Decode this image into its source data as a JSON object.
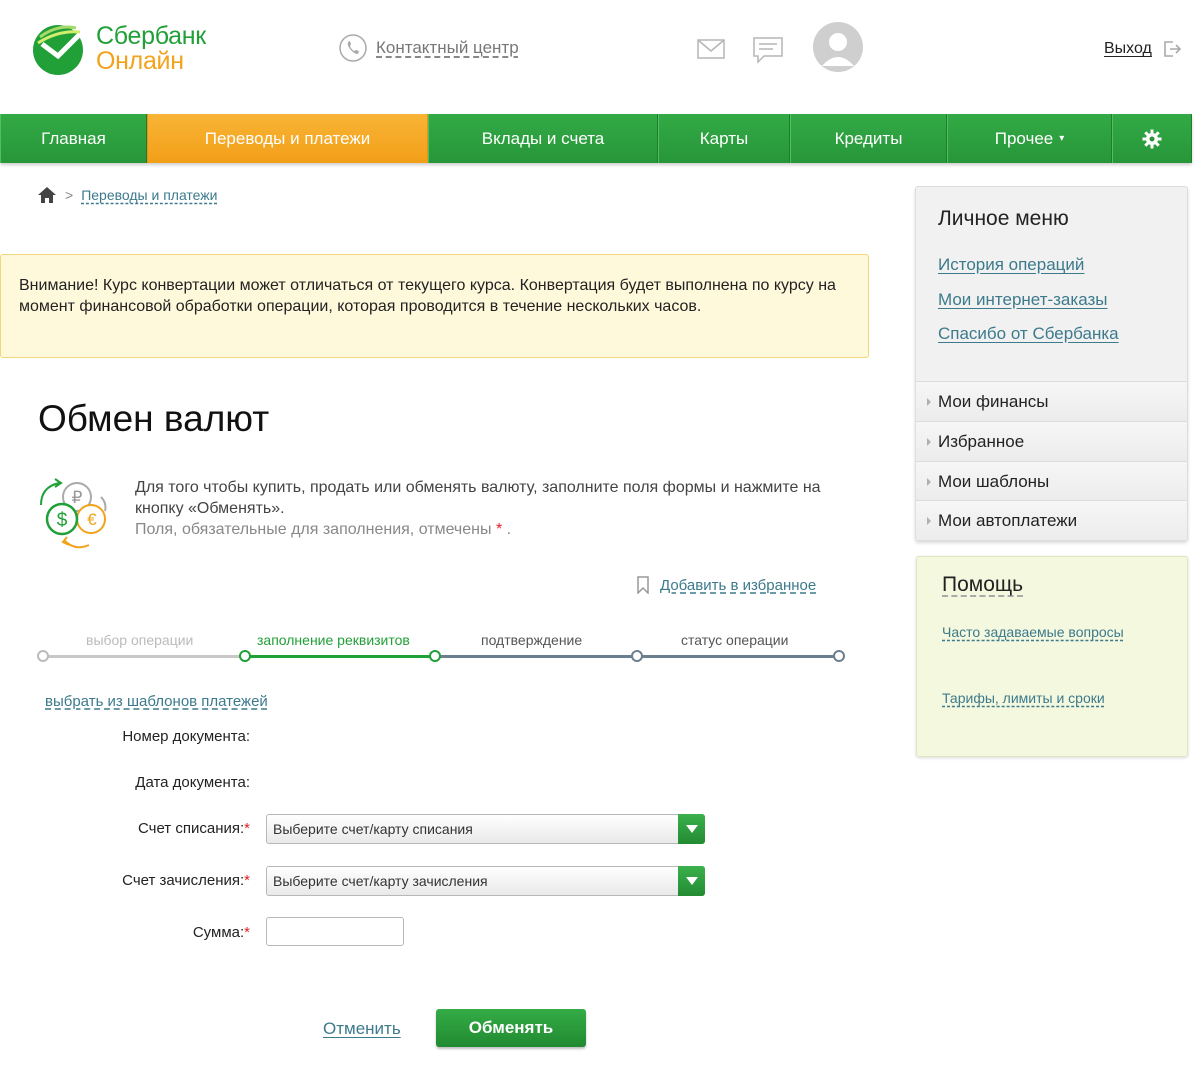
{
  "header": {
    "logo_line1": "Сбербанк",
    "logo_line2": "Онлайн",
    "contact_label": "Контактный центр",
    "exit_label": "Выход"
  },
  "nav": {
    "items": [
      {
        "label": "Главная",
        "active": false
      },
      {
        "label": "Переводы и платежи",
        "active": true
      },
      {
        "label": "Вклады и счета",
        "active": false
      },
      {
        "label": "Карты",
        "active": false
      },
      {
        "label": "Кредиты",
        "active": false
      },
      {
        "label": "Прочее",
        "active": false,
        "dropdown": true
      }
    ],
    "settings_icon": "gear-icon"
  },
  "breadcrumb": {
    "home_icon": "home-icon",
    "current": "Переводы и платежи"
  },
  "notice": {
    "text": "Внимание! Курс конвертации может отличаться от текущего курса. Конвертация будет выполнена по курсу на момент финансовой обработки операции, которая проводится в течение нескольких часов."
  },
  "page": {
    "title": "Обмен валют",
    "intro": "Для того чтобы купить, продать или обменять валюту, заполните поля формы и нажмите на кнопку «Обменять».",
    "required_note": "Поля, обязательные для заполнения, отмечены",
    "required_star": "*",
    "required_tail": ".",
    "favorite_label": "Добавить в избранное"
  },
  "steps": {
    "items": [
      {
        "label": "выбор операции",
        "state": "done"
      },
      {
        "label": "заполнение реквизитов",
        "state": "current"
      },
      {
        "label": "подтверждение",
        "state": "pending"
      },
      {
        "label": "статус операции",
        "state": "pending"
      }
    ]
  },
  "form": {
    "template_link": "выбрать из шаблонов платежей",
    "doc_number_label": "Номер документа:",
    "doc_date_label": "Дата документа:",
    "debit_label": "Счет списания:",
    "debit_value": "Выберите счет/карту списания",
    "credit_label": "Счет зачисления:",
    "credit_value": "Выберите счет/карту зачисления",
    "amount_label": "Сумма:",
    "amount_value": "",
    "star": "*",
    "cancel_label": "Отменить",
    "submit_label": "Обменять"
  },
  "sidebar": {
    "personal_title": "Личное меню",
    "links": [
      "История операций",
      "Мои интернет-заказы",
      "Спасибо от Сбербанка"
    ],
    "sections": [
      "Мои финансы",
      "Избранное",
      "Мои шаблоны",
      "Мои автоплатежи"
    ],
    "help_title": "Помощь",
    "help_links": [
      "Часто задаваемые вопросы",
      "Тарифы, лимиты и сроки"
    ]
  },
  "colors": {
    "brand_green": "#21a038",
    "brand_orange": "#f2a21b",
    "link": "#3c7a8c",
    "required": "#e02020"
  }
}
